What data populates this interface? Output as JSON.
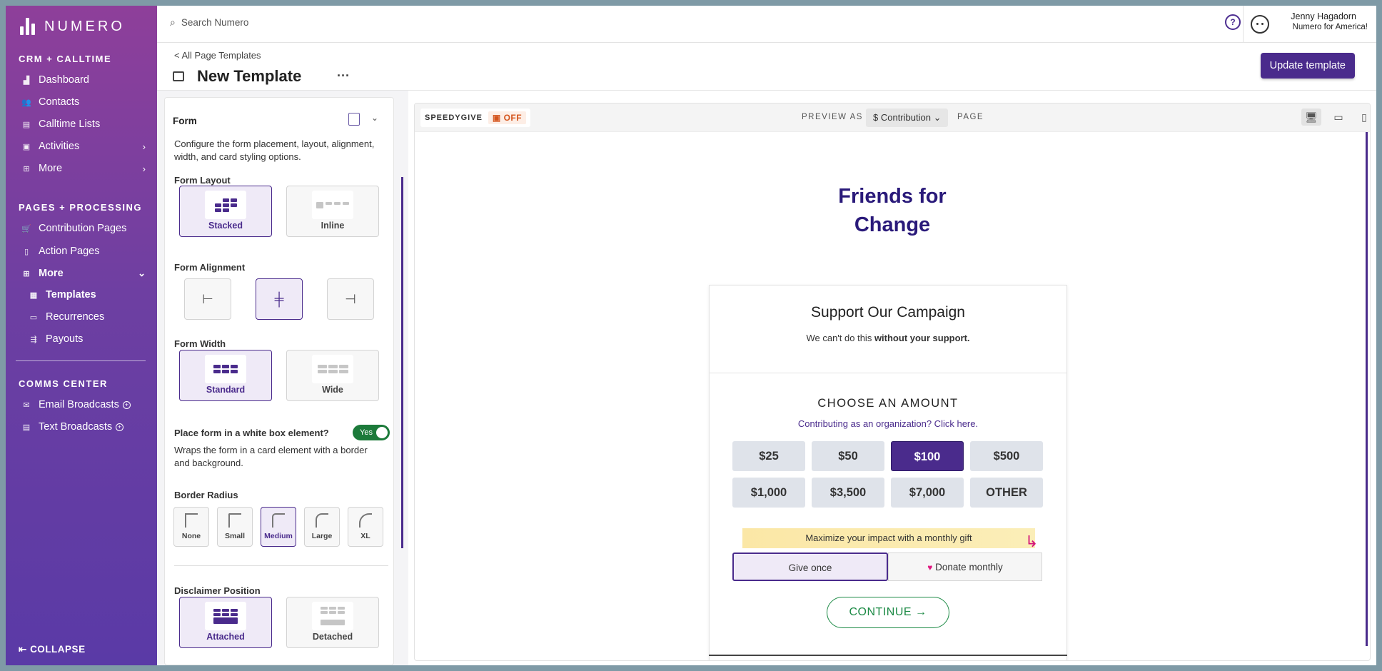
{
  "app": {
    "brand": "NUMERO"
  },
  "search": {
    "placeholder": "Search Numero"
  },
  "user": {
    "name": "Jenny Hagadorn",
    "org": "Numero for America!"
  },
  "sidebar": {
    "section1": "CRM + CALLTIME",
    "crm_items": [
      "Dashboard",
      "Contacts",
      "Calltime Lists",
      "Activities",
      "More"
    ],
    "section2": "PAGES + PROCESSING",
    "pages_items": [
      "Contribution Pages",
      "Action Pages",
      "More"
    ],
    "more_sub": [
      "Templates",
      "Recurrences",
      "Payouts"
    ],
    "section3": "COMMS CENTER",
    "comms_items": [
      "Email Broadcasts",
      "Text Broadcasts"
    ],
    "collapse": "COLLAPSE"
  },
  "header": {
    "breadcrumb": "< All Page Templates",
    "title": "New Template",
    "update_button": "Update template"
  },
  "panel": {
    "title": "Form",
    "description": "Configure the form placement, layout, alignment, width, and card styling options.",
    "layout_label": "Form Layout",
    "layout_options": [
      "Stacked",
      "Inline"
    ],
    "alignment_label": "Form Alignment",
    "width_label": "Form Width",
    "width_options": [
      "Standard",
      "Wide"
    ],
    "whitebox_label": "Place form in a white box element?",
    "toggle_text": "Yes",
    "whitebox_desc": "Wraps the form in a card element with a border and background.",
    "radius_label": "Border Radius",
    "radius_options": [
      "None",
      "Small",
      "Medium",
      "Large",
      "XL"
    ],
    "disclaimer_label": "Disclaimer Position",
    "disclaimer_options": [
      "Attached",
      "Detached"
    ]
  },
  "preview": {
    "speedygive": "SPEEDYGIVE",
    "speedygive_state": "OFF",
    "preview_as": "PREVIEW AS",
    "page_type": "$ Contribution",
    "page": "PAGE",
    "org_line1": "Friends for",
    "org_line2": "Change",
    "form_title": "Support Our Campaign",
    "subtitle_pre": "We can't do this ",
    "subtitle_bold": "without your support.",
    "choose": "CHOOSE AN AMOUNT",
    "org_link": "Contributing as an organization? Click here.",
    "amounts": [
      "$25",
      "$50",
      "$100",
      "$500",
      "$1,000",
      "$3,500",
      "$7,000",
      "OTHER"
    ],
    "selected_amount": "$100",
    "promo": "Maximize your impact with a monthly gift",
    "give_once": "Give once",
    "donate_monthly": "Donate monthly",
    "continue": "CONTINUE"
  },
  "colors": {
    "brand": "#4a2b8c",
    "toggle_on": "#1c7a3a",
    "continue": "#1c8a45",
    "off": "#d4541c"
  }
}
